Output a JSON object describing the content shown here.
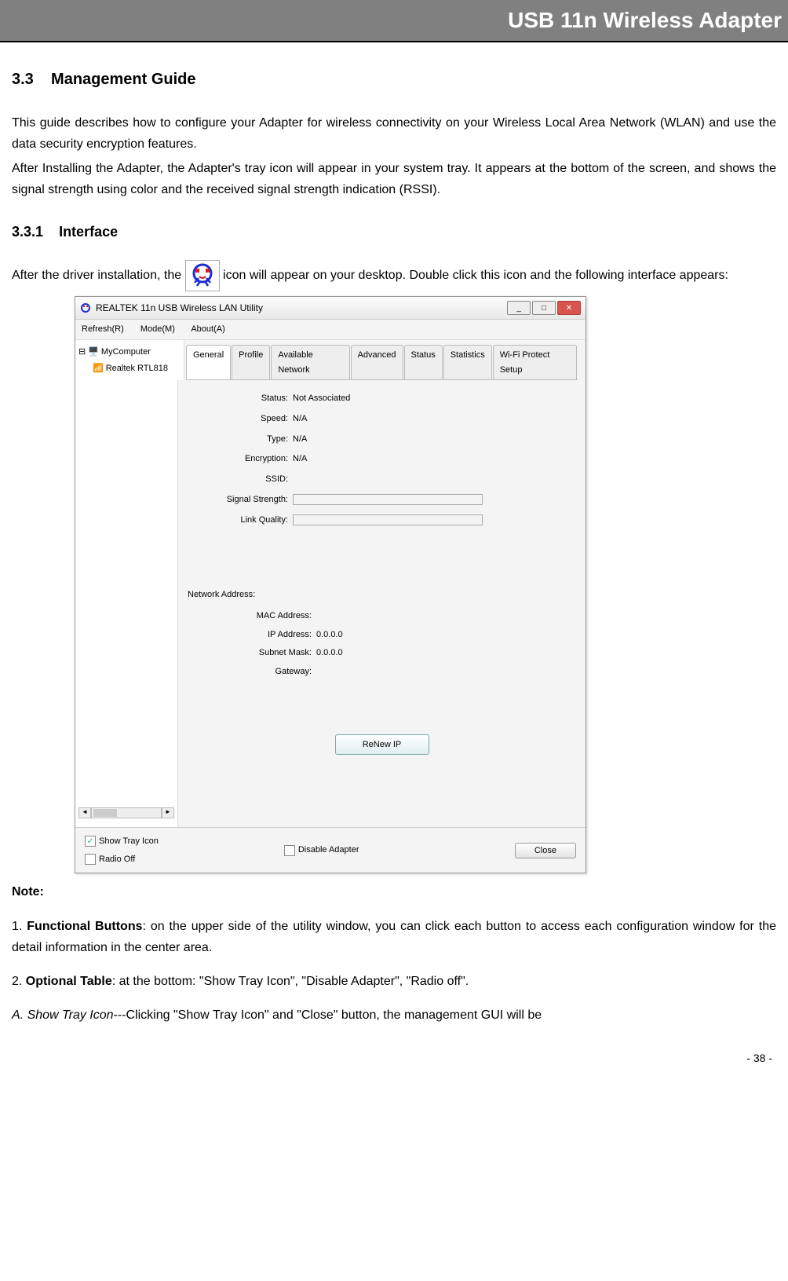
{
  "header": "USB 11n Wireless Adapter",
  "section_num": "3.3",
  "section_title": "Management Guide",
  "para1": "This guide describes how to configure your Adapter for wireless connectivity on your Wireless Local Area Network (WLAN) and use the data security encryption features.",
  "para2": "After Installing the Adapter, the Adapter's tray icon will appear in your system tray. It appears at the bottom of the screen, and shows the signal strength using color and the received signal strength indication (RSSI).",
  "subsection_num": "3.3.1",
  "subsection_title": "Interface",
  "para3a": "After the driver installation, the ",
  "para3b": " icon will appear on your desktop. Double click this icon and the following interface appears:",
  "screenshot": {
    "title": "REALTEK 11n USB Wireless LAN Utility",
    "menu": {
      "refresh": "Refresh(R)",
      "mode": "Mode(M)",
      "about": "About(A)"
    },
    "tree": {
      "root": "MyComputer",
      "child": "Realtek RTL818"
    },
    "tabs": [
      "General",
      "Profile",
      "Available Network",
      "Advanced",
      "Status",
      "Statistics",
      "Wi-Fi Protect Setup"
    ],
    "rows": {
      "status_lbl": "Status:",
      "status_val": "Not Associated",
      "speed_lbl": "Speed:",
      "speed_val": "N/A",
      "type_lbl": "Type:",
      "type_val": "N/A",
      "enc_lbl": "Encryption:",
      "enc_val": "N/A",
      "ssid_lbl": "SSID:",
      "ssid_val": "",
      "sig_lbl": "Signal Strength:",
      "link_lbl": "Link Quality:"
    },
    "net_title": "Network Address:",
    "net": {
      "mac_lbl": "MAC Address:",
      "mac_val": "",
      "ip_lbl": "IP Address:",
      "ip_val": "0.0.0.0",
      "mask_lbl": "Subnet Mask:",
      "mask_val": "0.0.0.0",
      "gw_lbl": "Gateway:",
      "gw_val": ""
    },
    "renew": "ReNew IP",
    "bottom": {
      "show_tray": "Show Tray Icon",
      "radio_off": "Radio Off",
      "disable": "Disable Adapter",
      "close": "Close"
    }
  },
  "note_label": "Note:",
  "item1_prefix": "1. ",
  "item1_bold": "Functional Buttons",
  "item1_rest": ": on the upper side of the utility window, you can click each button to access each configuration window for the detail information in the center area.",
  "item2_prefix": "2. ",
  "item2_bold": "Optional Table",
  "item2_rest": ": at the bottom: \"Show Tray Icon\", \"Disable Adapter\", \"Radio off\".",
  "item3_italic": "A. Show Tray Icon",
  "item3_rest": "---Clicking \"Show Tray Icon\" and \"Close\" button, the management GUI will be",
  "page_number": "- 38 -"
}
